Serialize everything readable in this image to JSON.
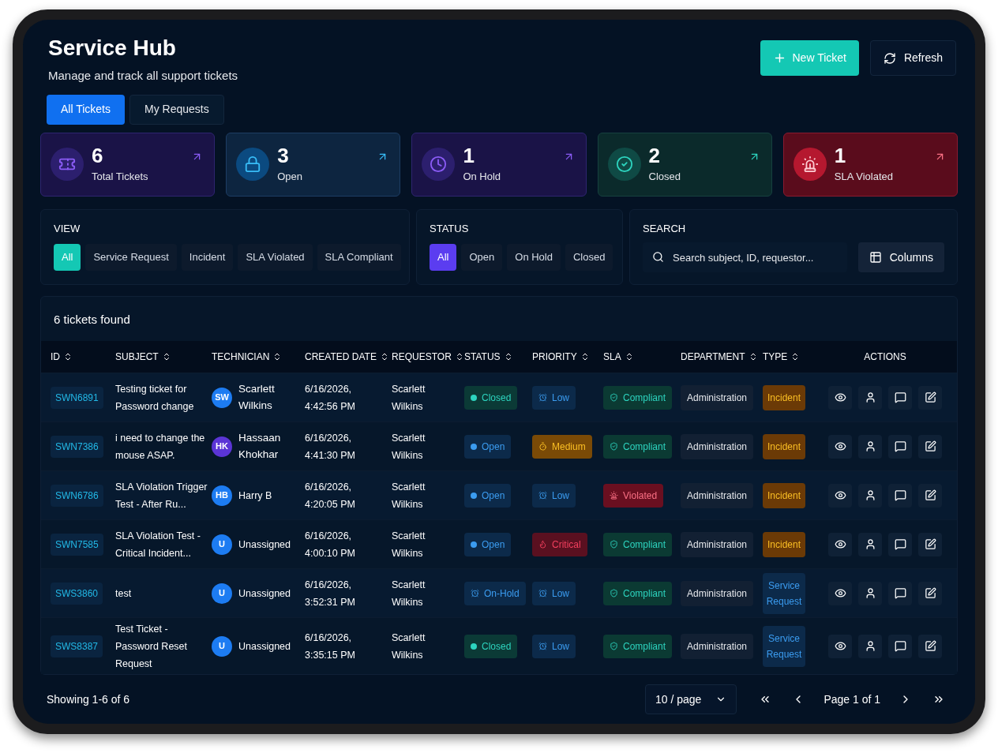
{
  "header": {
    "title": "Service Hub",
    "subtitle": "Manage and track all support tickets",
    "new_button": "New Ticket",
    "refresh_button": "Refresh"
  },
  "tabs": [
    {
      "label": "All Tickets",
      "selected": true
    },
    {
      "label": "My Requests",
      "selected": false
    }
  ],
  "stats": [
    {
      "kind": "total",
      "value": "6",
      "label": "Total Tickets"
    },
    {
      "kind": "open",
      "value": "3",
      "label": "Open"
    },
    {
      "kind": "hold",
      "value": "1",
      "label": "On Hold"
    },
    {
      "kind": "closed",
      "value": "2",
      "label": "Closed"
    },
    {
      "kind": "violated",
      "value": "1",
      "label": "SLA Violated"
    }
  ],
  "view_filter": {
    "title": "VIEW",
    "options": [
      {
        "label": "All",
        "selected": true
      },
      {
        "label": "Service Request",
        "selected": false
      },
      {
        "label": "Incident",
        "selected": false
      },
      {
        "label": "SLA Violated",
        "selected": false
      },
      {
        "label": "SLA Compliant",
        "selected": false
      }
    ]
  },
  "status_filter": {
    "title": "STATUS",
    "options": [
      {
        "label": "All",
        "selected": true
      },
      {
        "label": "Open",
        "selected": false
      },
      {
        "label": "On Hold",
        "selected": false
      },
      {
        "label": "Closed",
        "selected": false
      }
    ]
  },
  "search": {
    "title": "SEARCH",
    "placeholder": "Search subject, ID, requestor...",
    "columns_button": "Columns"
  },
  "table": {
    "count": "6 tickets found",
    "columns": [
      "ID",
      "SUBJECT",
      "TECHNICIAN",
      "CREATED DATE",
      "REQUESTOR",
      "STATUS",
      "PRIORITY",
      "SLA",
      "DEPARTMENT",
      "TYPE",
      "ACTIONS"
    ],
    "rows": [
      {
        "id": "SWN6891",
        "subject": "Testing ticket for Password change",
        "avatar": {
          "initials": "SW",
          "color": "#1d7cf2"
        },
        "technician": "Scarlett Wilkins",
        "created": "6/16/2026, 4:42:56 PM",
        "requestor": "Scarlett Wilkins",
        "status": {
          "kind": "closed",
          "label": "Closed"
        },
        "priority": {
          "kind": "low",
          "label": "Low"
        },
        "sla": {
          "kind": "compliant",
          "label": "Compliant"
        },
        "department": "Administration",
        "type": {
          "kind": "incident",
          "label": "Incident"
        }
      },
      {
        "id": "SWN7386",
        "subject": "i need to change the mouse ASAP.",
        "avatar": {
          "initials": "HK",
          "color": "#5b35d5"
        },
        "technician": "Hassaan Khokhar",
        "created": "6/16/2026, 4:41:30 PM",
        "requestor": "Scarlett Wilkins",
        "status": {
          "kind": "open",
          "label": "Open"
        },
        "priority": {
          "kind": "medium",
          "label": "Medium"
        },
        "sla": {
          "kind": "compliant",
          "label": "Compliant"
        },
        "department": "Administration",
        "type": {
          "kind": "incident",
          "label": "Incident"
        }
      },
      {
        "id": "SWN6786",
        "subject": "SLA Violation Trigger Test - After Ru...",
        "avatar": {
          "initials": "HB",
          "color": "#1d7cf2"
        },
        "technician": "Harry B",
        "created": "6/16/2026, 4:20:05 PM",
        "requestor": "Scarlett Wilkins",
        "status": {
          "kind": "open",
          "label": "Open"
        },
        "priority": {
          "kind": "low",
          "label": "Low"
        },
        "sla": {
          "kind": "violated",
          "label": "Violated"
        },
        "department": "Administration",
        "type": {
          "kind": "incident",
          "label": "Incident"
        }
      },
      {
        "id": "SWN7585",
        "subject": "SLA Violation Test - Critical Incident...",
        "avatar": {
          "initials": "U",
          "color": "#1d7cf2"
        },
        "technician": "Unassigned",
        "created": "6/16/2026, 4:00:10 PM",
        "requestor": "Scarlett Wilkins",
        "status": {
          "kind": "open",
          "label": "Open"
        },
        "priority": {
          "kind": "critical",
          "label": "Critical"
        },
        "sla": {
          "kind": "compliant",
          "label": "Compliant"
        },
        "department": "Administration",
        "type": {
          "kind": "incident",
          "label": "Incident"
        }
      },
      {
        "id": "SWS3860",
        "subject": "test",
        "avatar": {
          "initials": "U",
          "color": "#1d7cf2"
        },
        "technician": "Unassigned",
        "created": "6/16/2026, 3:52:31 PM",
        "requestor": "Scarlett Wilkins",
        "status": {
          "kind": "hold",
          "label": "On-Hold"
        },
        "priority": {
          "kind": "low",
          "label": "Low"
        },
        "sla": {
          "kind": "compliant",
          "label": "Compliant"
        },
        "department": "Administration",
        "type": {
          "kind": "service",
          "label": "Service Request"
        }
      },
      {
        "id": "SWS8387",
        "subject": "Test Ticket - Password Reset Request",
        "avatar": {
          "initials": "U",
          "color": "#1d7cf2"
        },
        "technician": "Unassigned",
        "created": "6/16/2026, 3:35:15 PM",
        "requestor": "Scarlett Wilkins",
        "status": {
          "kind": "closed",
          "label": "Closed"
        },
        "priority": {
          "kind": "low",
          "label": "Low"
        },
        "sla": {
          "kind": "compliant",
          "label": "Compliant"
        },
        "department": "Administration",
        "type": {
          "kind": "service",
          "label": "Service Request"
        }
      }
    ]
  },
  "footer": {
    "showing": "Showing 1-6 of 6",
    "page_size": "10 / page",
    "page": "Page 1 of 1"
  }
}
